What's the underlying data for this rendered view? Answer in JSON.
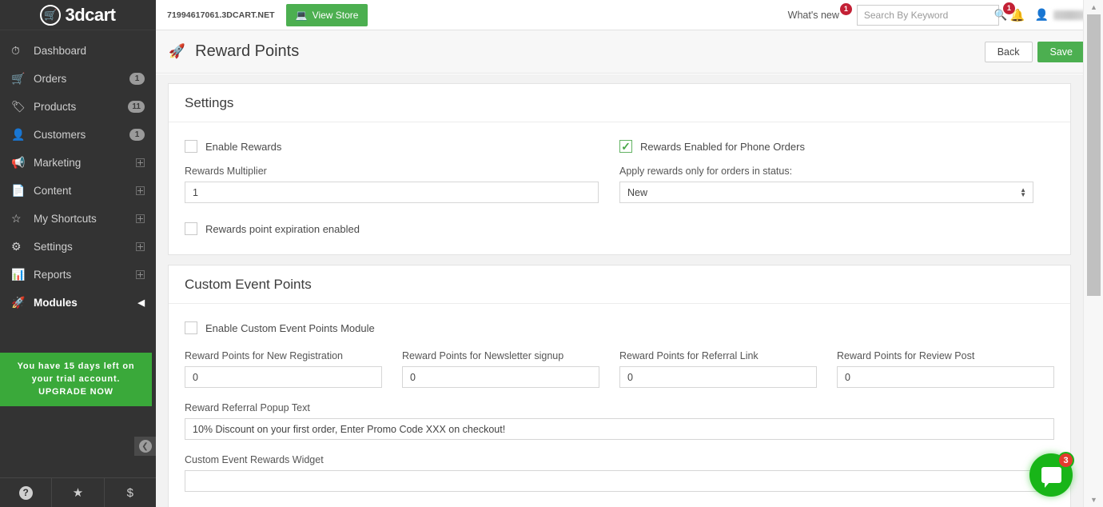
{
  "sidebar": {
    "logo_text": "3dcart",
    "logo_icon": "shopping-cart-icon",
    "items": [
      {
        "label": "Dashboard",
        "icon": "speedometer-icon",
        "badge": null,
        "expander": false,
        "active": false
      },
      {
        "label": "Orders",
        "icon": "shopping-cart-icon",
        "badge": "1",
        "expander": false,
        "active": false
      },
      {
        "label": "Products",
        "icon": "tags-icon",
        "badge": "11",
        "expander": false,
        "active": false
      },
      {
        "label": "Customers",
        "icon": "user-icon",
        "badge": "1",
        "expander": false,
        "active": false
      },
      {
        "label": "Marketing",
        "icon": "megaphone-icon",
        "badge": null,
        "expander": true,
        "active": false
      },
      {
        "label": "Content",
        "icon": "document-icon",
        "badge": null,
        "expander": true,
        "active": false
      },
      {
        "label": "My Shortcuts",
        "icon": "star-icon",
        "badge": null,
        "expander": true,
        "active": false
      },
      {
        "label": "Settings",
        "icon": "gears-icon",
        "badge": null,
        "expander": true,
        "active": false
      },
      {
        "label": "Reports",
        "icon": "bar-chart-icon",
        "badge": null,
        "expander": true,
        "active": false
      },
      {
        "label": "Modules",
        "icon": "rocket-icon",
        "badge": null,
        "expander": false,
        "active": true
      }
    ],
    "trial_notice": "You have 15 days left on your trial account. UPGRADE NOW",
    "footer_items": [
      {
        "icon": "help-circle-icon",
        "glyph": "?"
      },
      {
        "icon": "star-icon",
        "glyph": "★"
      },
      {
        "icon": "dollar-icon",
        "glyph": "$"
      }
    ]
  },
  "topbar": {
    "store_url": "71994617061.3DCART.NET",
    "view_store_label": "View Store",
    "view_store_icon": "monitor-icon",
    "whats_new_label": "What's new",
    "whats_new_count": "1",
    "search_placeholder": "Search By Keyword",
    "search_value": "",
    "search_icon": "search-icon",
    "bell_icon": "bell-icon",
    "bell_count": "1",
    "user_icon": "user-avatar-icon"
  },
  "page": {
    "icon": "rocket-icon",
    "title": "Reward Points",
    "back_label": "Back",
    "save_label": "Save"
  },
  "settings_panel": {
    "heading": "Settings",
    "enable_rewards": {
      "label": "Enable Rewards",
      "checked": false
    },
    "phone_orders": {
      "label": "Rewards Enabled for Phone Orders",
      "checked": true
    },
    "multiplier": {
      "label": "Rewards Multiplier",
      "value": "1"
    },
    "status_filter": {
      "label": "Apply rewards only for orders in status:",
      "value": "New"
    },
    "expiration": {
      "label": "Rewards point expiration enabled",
      "checked": false
    }
  },
  "custom_event_panel": {
    "heading": "Custom Event Points",
    "enable_module": {
      "label": "Enable Custom Event Points Module",
      "checked": false
    },
    "point_fields": [
      {
        "label": "Reward Points for New Registration",
        "value": "0"
      },
      {
        "label": "Reward Points for Newsletter signup",
        "value": "0"
      },
      {
        "label": "Reward Points for Referral Link",
        "value": "0"
      },
      {
        "label": "Reward Points for Review Post",
        "value": "0"
      }
    ],
    "popup_text": {
      "label": "Reward Referral Popup Text",
      "value": "10% Discount on your first order, Enter Promo Code XXX on checkout!"
    },
    "widget_label": "Custom Event Rewards Widget",
    "widget_value": ""
  },
  "chat": {
    "icon": "chat-bubble-icon",
    "count": "3"
  },
  "colors": {
    "brand_green": "#4caf50",
    "sidebar_bg": "#333333",
    "badge_red": "#c32035",
    "chat_green": "#18b518"
  }
}
